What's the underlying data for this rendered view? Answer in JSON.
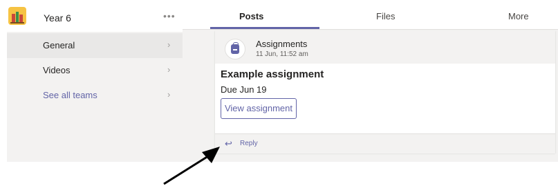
{
  "sidebar": {
    "team_name": "Year 6",
    "more_label": "•••",
    "items": [
      {
        "label": "General"
      },
      {
        "label": "Videos"
      },
      {
        "label": "See all teams"
      }
    ],
    "chevron": "›"
  },
  "tabs": [
    {
      "label": "Posts",
      "active": true
    },
    {
      "label": "Files",
      "active": false
    },
    {
      "label": "More",
      "active": false
    }
  ],
  "post": {
    "app_name": "Assignments",
    "timestamp": "11 Jun, 11:52 am",
    "title": "Example assignment",
    "due": "Due Jun 19",
    "button_label": "View assignment",
    "reply_label": "Reply",
    "reply_icon": "↩"
  },
  "colors": {
    "accent": "#6264a7",
    "sidebar_bg": "#f3f2f1",
    "arrow": "#000000"
  },
  "icons": {
    "team_logo": "bookshelf-icon",
    "app_icon": "backpack-icon",
    "reply": "reply-arrow-icon",
    "annotation": "pointer-arrow"
  }
}
